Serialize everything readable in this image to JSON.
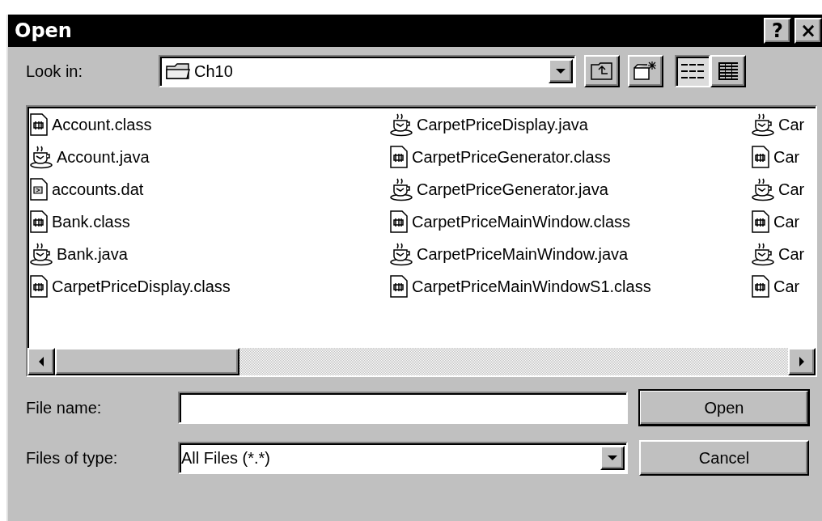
{
  "window": {
    "title": "Open",
    "buttons": [
      "?",
      "×"
    ]
  },
  "look_in": {
    "label": "Look in:",
    "value": "Ch10"
  },
  "files": [
    {
      "name": "Account.class",
      "kind": "class"
    },
    {
      "name": "Account.java",
      "kind": "java"
    },
    {
      "name": "accounts.dat",
      "kind": "dat"
    },
    {
      "name": "Bank.class",
      "kind": "class"
    },
    {
      "name": "Bank.java",
      "kind": "java"
    },
    {
      "name": "CarpetPriceDisplay.class",
      "kind": "class"
    },
    {
      "name": "CarpetPriceDisplay.java",
      "kind": "java"
    },
    {
      "name": "CarpetPriceGenerator.class",
      "kind": "class"
    },
    {
      "name": "CarpetPriceGenerator.java",
      "kind": "java"
    },
    {
      "name": "CarpetPriceMainWindow.class",
      "kind": "class"
    },
    {
      "name": "CarpetPriceMainWindow.java",
      "kind": "java"
    },
    {
      "name": "CarpetPriceMainWindowS1.class",
      "kind": "class"
    },
    {
      "name": "Car",
      "kind": "java"
    },
    {
      "name": "Car",
      "kind": "class"
    },
    {
      "name": "Car",
      "kind": "java"
    },
    {
      "name": "Car",
      "kind": "class"
    },
    {
      "name": "Car",
      "kind": "java"
    },
    {
      "name": "Car",
      "kind": "class"
    }
  ],
  "file_name": {
    "label": "File name:"
  },
  "file_type": {
    "label": "Files of type:",
    "value": "All Files (*.*)"
  },
  "buttons": [
    {
      "label": "Open",
      "default": true
    },
    {
      "label": "Cancel",
      "default": false
    }
  ]
}
